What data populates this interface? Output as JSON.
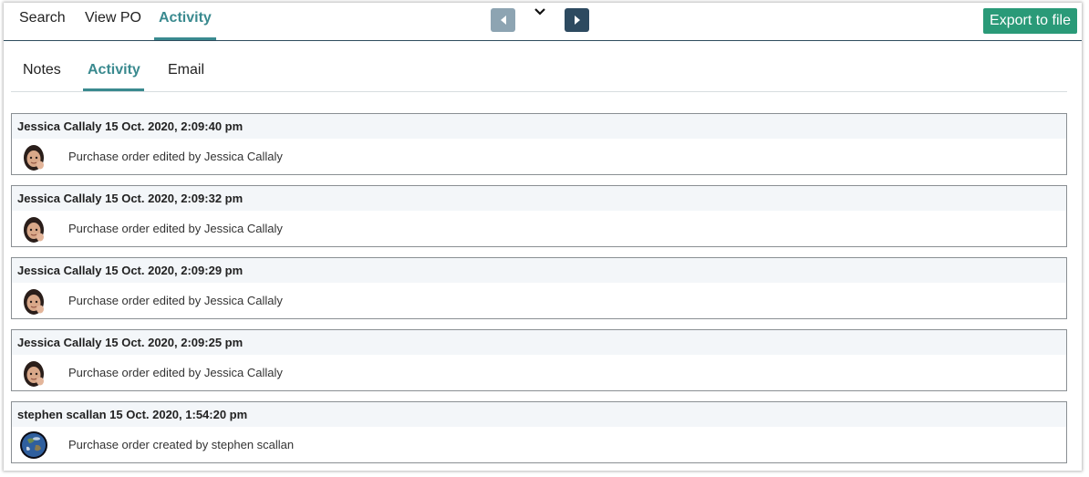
{
  "top_tabs": [
    "Search",
    "View PO",
    "Activity"
  ],
  "export_label": "Export to file",
  "sub_tabs": [
    "Notes",
    "Activity",
    "Email"
  ],
  "activities": [
    {
      "header": "Jessica Callaly 15 Oct. 2020, 2:09:40 pm",
      "text": "Purchase order edited by Jessica Callaly",
      "avatar": "memoji-avatar"
    },
    {
      "header": "Jessica Callaly 15 Oct. 2020, 2:09:32 pm",
      "text": "Purchase order edited by Jessica Callaly",
      "avatar": "memoji-avatar"
    },
    {
      "header": "Jessica Callaly 15 Oct. 2020, 2:09:29 pm",
      "text": "Purchase order edited by Jessica Callaly",
      "avatar": "memoji-avatar"
    },
    {
      "header": "Jessica Callaly 15 Oct. 2020, 2:09:25 pm",
      "text": "Purchase order edited by Jessica Callaly",
      "avatar": "memoji-avatar"
    },
    {
      "header": "stephen scallan 15 Oct. 2020, 1:54:20 pm",
      "text": "Purchase order created by stephen scallan",
      "avatar": "earth-avatar"
    }
  ],
  "colors": {
    "accent": "#3a8a8f",
    "export_button": "#2a9a78",
    "nav_prev": "#8da4b2",
    "nav_next": "#2d4a60"
  }
}
